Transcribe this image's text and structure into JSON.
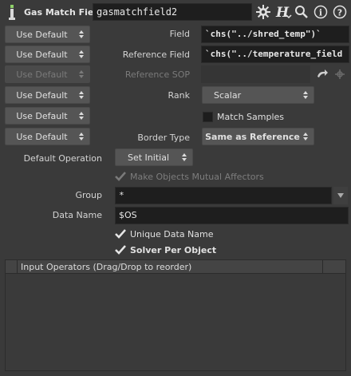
{
  "header": {
    "node_type": "Gas Match Field",
    "node_name": "gasmatchfield2",
    "icons": [
      "gear-icon",
      "h-help-icon",
      "search-icon",
      "info-icon",
      "help-icon"
    ]
  },
  "params": {
    "use_default": "Use Default",
    "field_label": "Field",
    "field_value": "`chs(\"../shred_temp\")`",
    "reference_field_label": "Reference Field",
    "reference_field_value": "`chs(\"../temperature_field",
    "reference_sop_label": "Reference SOP",
    "reference_sop_value": "",
    "rank_label": "Rank",
    "rank_value": "Scalar",
    "match_samples_label": "Match Samples",
    "border_type_label": "Border Type",
    "border_type_value": "Same as Reference",
    "default_operation_label": "Default Operation",
    "default_operation_value": "Set Initial",
    "mutual_affectors_label": "Make Objects Mutual Affectors",
    "group_label": "Group",
    "group_value": "*",
    "data_name_label": "Data Name",
    "data_name_value": "$OS",
    "unique_data_name_label": "Unique Data Name",
    "solver_per_object_label": "Solver Per Object"
  },
  "input_operators": {
    "header": "Input Operators (Drag/Drop to reorder)"
  },
  "colors": {
    "background": "#3a3a3a",
    "field_bg": "#1e1e1e",
    "button_bg": "#555555"
  }
}
